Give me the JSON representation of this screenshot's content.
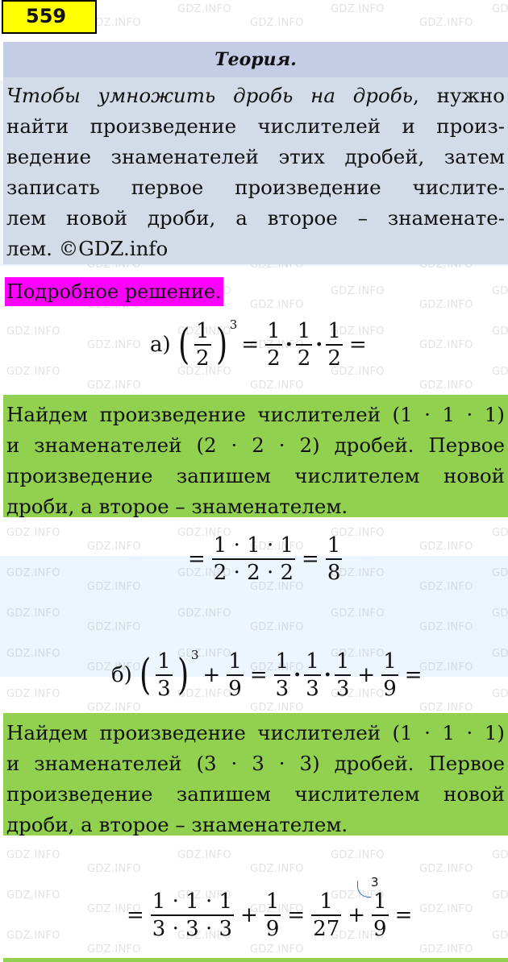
{
  "task": {
    "number": "559"
  },
  "theory": {
    "title": "Теория.",
    "lines": [
      {
        "italic": "Чтобы умножить дробь на дробь",
        "rest": ", нужно"
      },
      {
        "italic": "",
        "rest": "найти произведение числителей и произ-"
      },
      {
        "italic": "",
        "rest": "ведение знаменателей этих дробей, затем"
      },
      {
        "italic": "",
        "rest": "записать первое произведение числите-"
      },
      {
        "italic": "",
        "rest": "лем новой дроби, а второе – знаменате-"
      },
      {
        "italic": "",
        "rest": "лем. ©GDZ.info"
      }
    ]
  },
  "solution_label": "Подробное решение.",
  "part_a": {
    "label": "а)",
    "power_base": {
      "num": "1",
      "den": "2"
    },
    "exponent": "3",
    "expansion": [
      {
        "num": "1",
        "den": "2"
      },
      {
        "num": "1",
        "den": "2"
      },
      {
        "num": "1",
        "den": "2"
      }
    ],
    "explanation": [
      "Найдем произведение числителей (1 · 1 · 1)",
      "и знаменателей (2 · 2 · 2) дробей. Первое",
      "произведение запишем числителем новой",
      "дроби, а второе – знаменателем."
    ],
    "result_num": "1 · 1 · 1",
    "result_den": "2 · 2 · 2",
    "answer": {
      "num": "1",
      "den": "8"
    }
  },
  "part_b": {
    "label": "б)",
    "power_base": {
      "num": "1",
      "den": "3"
    },
    "exponent": "3",
    "addend": {
      "num": "1",
      "den": "9"
    },
    "expansion": [
      {
        "num": "1",
        "den": "3"
      },
      {
        "num": "1",
        "den": "3"
      },
      {
        "num": "1",
        "den": "3"
      }
    ],
    "explanation": [
      "Найдем произведение числителей (1 · 1 · 1)",
      "и знаменателей (3 · 3 · 3) дробей. Первое",
      "произведение запишем числителем новой",
      "дроби, а второе – знаменателем."
    ],
    "result_num": "1 · 1 · 1",
    "result_den": "3 · 3 · 3",
    "step": {
      "num": "1",
      "den": "27"
    },
    "addend2": {
      "num": "1",
      "den": "9"
    },
    "extra_factor": "3"
  },
  "watermark": "GDZ.INFO"
}
